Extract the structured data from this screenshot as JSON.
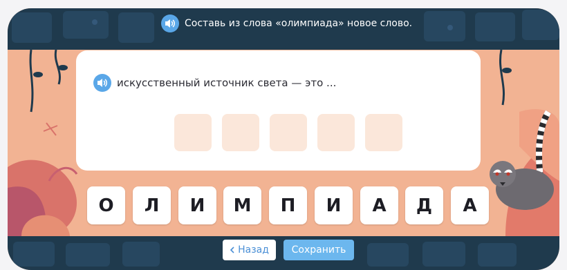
{
  "header": {
    "instruction": "Составь из слова «олимпиада» новое слово.",
    "audio_icon": "speaker-icon"
  },
  "question": {
    "text": "искусственный источник света — это ...",
    "audio_icon": "speaker-icon",
    "answer_slots_count": 5
  },
  "letters": [
    "О",
    "Л",
    "И",
    "М",
    "П",
    "И",
    "А",
    "Д",
    "А"
  ],
  "buttons": {
    "back_label": "Назад",
    "back_icon": "chevron-left-icon",
    "save_label": "Сохранить"
  },
  "colors": {
    "frame_dark": "#1f3a4d",
    "background_peach": "#f2b393",
    "accent_blue": "#5aa7e8",
    "save_button": "#6cb7ee",
    "slot_fill": "#fbe7da"
  }
}
